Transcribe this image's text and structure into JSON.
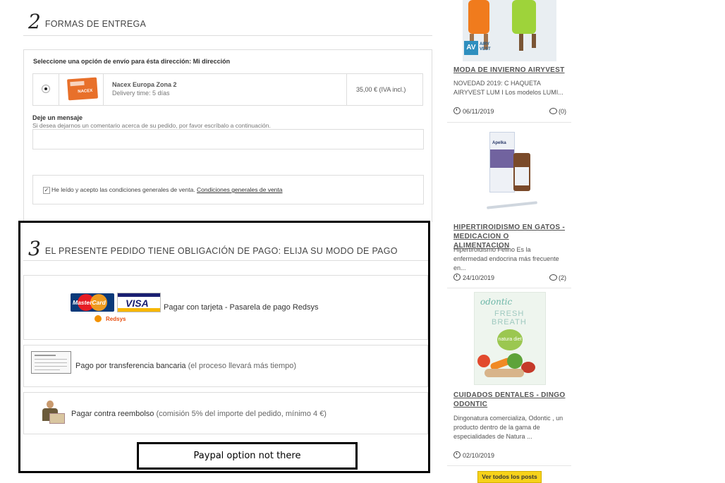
{
  "step2": {
    "number": "2",
    "title": "FORMAS DE ENTREGA",
    "select_label": "Seleccione una opción de envío para ésta dirección: Mi dirección",
    "carrier": {
      "name": "Nacex Europa Zona 2",
      "delay": "Delivery time: 5 días",
      "price": "35,00 € (IVA incl.)",
      "logo_text": "NACEX"
    },
    "message": {
      "label": "Deje un mensaje",
      "hint": "Si desea dejarnos un comentario acerca de su pedido, por favor escríbalo a continuación.",
      "value": ""
    },
    "terms": {
      "text": "He leído y acepto las condiciones generales de venta.",
      "link": "Condiciones generales de venta",
      "checked": true
    }
  },
  "step3": {
    "number": "3",
    "title": "EL PRESENTE PEDIDO TIENE OBLIGACIÓN DE PAGO: ELIJA SU MODO DE PAGO",
    "options": [
      {
        "label": "Pagar con tarjeta - Pasarela de pago Redsys",
        "note": ""
      },
      {
        "label": "Pago por transferencia bancaria",
        "note": "(el proceso llevará más tiempo)"
      },
      {
        "label": "Pagar contra reembolso",
        "note": "(comisión 5% del importe del pedido, mínimo 4 €)"
      }
    ],
    "card_logos": {
      "mastercard": "MasterCard",
      "visa": "VISA",
      "redsys": "Redsys"
    },
    "annotation": "Paypal option not there"
  },
  "sidebar": {
    "posts": [
      {
        "image_badge": "AIRY VEST",
        "title": "MODA DE INVIERNO AIRYVEST",
        "excerpt": "NOVEDAD 2019: C HAQUETA AIRYVEST LUM I Los modelos LUMI...",
        "date": "06/11/2019",
        "comments": "(0)"
      },
      {
        "image_badge": "Apelka",
        "title": "HIPERTIROIDISMO EN GATOS - MEDICACION O ALIMENTACION",
        "excerpt": "Hipertiroidismo Felino Es la enfermedad endocrina más frecuente en...",
        "date": "24/10/2019",
        "comments": "(2)"
      },
      {
        "image_badge": "odontic",
        "image_sub1": "FRESH",
        "image_sub2": "BREATH",
        "image_sub3": "natura diet",
        "title": "CUIDADOS DENTALES - DINGO ODONTIC",
        "excerpt": "Dingonatura comercializa, Odontic , un producto dentro de la gama de especialidades de Natura ...",
        "date": "02/10/2019",
        "comments": ""
      }
    ],
    "all_posts_button": "Ver todos los posts"
  }
}
